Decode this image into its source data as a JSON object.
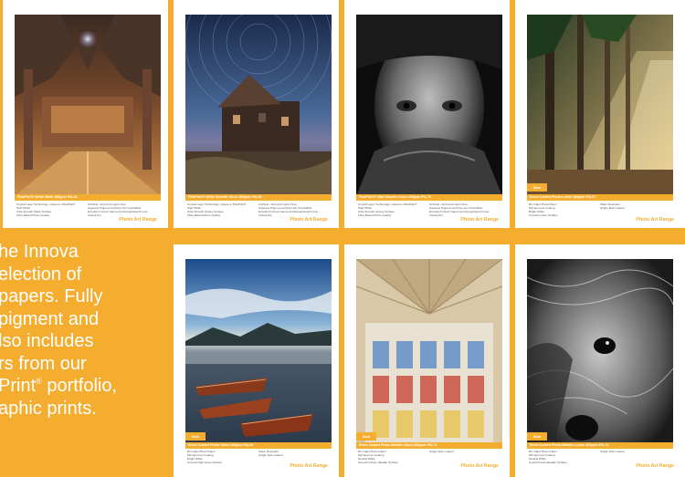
{
  "intro_lines": [
    "he Innova",
    "election of",
    "papers. Fully",
    "pigment and",
    "lso includes",
    "rs from our",
    "Print",
    "aphic prints."
  ],
  "intro_line7_suffix": "portfolio,",
  "intro_registered": "®",
  "cards": [
    {
      "badge": "",
      "product": "FibaPrint® White Matte 285gsm IFA-44",
      "features": [
        "Crystal Layer Technology, unique to FibaPrint®",
        "Archival - Acid and Lignin Free",
        "High White",
        "Aqueous Pigment and Dye Ink Compatible",
        "Ultra Smooth Matte Surface",
        "Excellent Colour Gamut and Exceptional D-max",
        "Fibre Based Photo Quality",
        "Instant Dry"
      ],
      "range": "Photo Art Range"
    },
    {
      "badge": "",
      "product": "FibaPrint® White Smooth Gloss 300gsm IFA-69",
      "features": [
        "Crystal Layer Technology, unique to FibaPrint®",
        "Archival - Acid and Lignin Free",
        "High White",
        "Aqueous Pigment and Dye Ink Compatible",
        "Ultra Smooth Glossy Surface",
        "Excellent Colour Gamut and Exceptional D-max",
        "Fibre Based Photo Quality",
        "Instant Dry"
      ],
      "range": "Photo Art Range"
    },
    {
      "badge": "",
      "product": "FibaPrint® Ultra Smooth Gloss 285gsm IFA-70",
      "features": [
        "Crystal Layer Technology, unique to FibaPrint®",
        "Archival - Acid and Lignin Free",
        "High White",
        "Aqueous Pigment and Dye Ink Compatible",
        "Ultra Smooth Glossy Surface",
        "Excellent Colour Gamut and Exceptional D-max",
        "Fibre Based Photo Quality",
        "Instant Dry"
      ],
      "range": "Photo Art Range"
    },
    {
      "badge": "New",
      "product": "Resin Coated Photo Lustre 280gsm IFA-07",
      "features": [
        "RC Inkjet Photo Paper",
        "Water Resistant",
        "Microporous Coating",
        "Single Side Coated",
        "Bright White",
        "",
        "Smooth Lustre Surface",
        ""
      ],
      "range": "Photo Art Range"
    },
    {
      "badge": "New",
      "product": "Resin Coated Photo Gloss 280gsm IFA-08",
      "features": [
        "RC Inkjet Photo Paper",
        "Water Resistant",
        "Microporous Coating",
        "Single Side Coated",
        "Bright White",
        "",
        "Smooth High Gloss Surface",
        ""
      ],
      "range": "Photo Art Range"
    },
    {
      "badge": "New",
      "product": "Resin Coated Photo Metallic Gloss 300gsm IFA-71",
      "features": [
        "RC Inkjet Photo Paper",
        "Single Side Coated",
        "Microporous Coating",
        "",
        "Neutral White",
        "",
        "Smooth Glossy Metallic Surface",
        ""
      ],
      "range": "Photo Art Range"
    },
    {
      "badge": "New",
      "product": "Resin Coated Photo Metallic Lustre 300gsm IFA-72",
      "features": [
        "RC Inkjet Photo Paper",
        "Single Side Coated",
        "Microporous Coating",
        "",
        "Neutral White",
        "",
        "Smooth Pearl Metallic Surface",
        ""
      ],
      "range": "Photo Art Range"
    }
  ],
  "colors": {
    "accent": "#f4ad2f",
    "card": "#ffffff"
  }
}
